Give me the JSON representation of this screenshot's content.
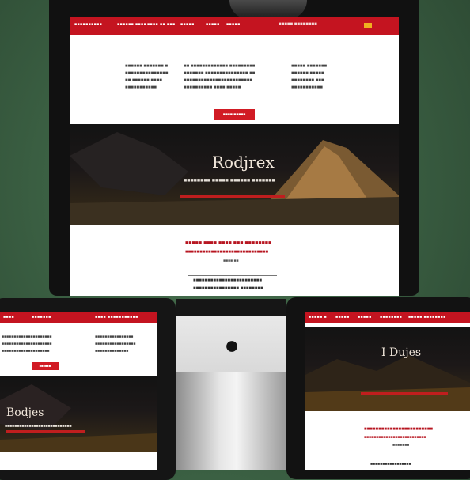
{
  "colors": {
    "brand_red": "#c41420",
    "hero_dark": "#161616",
    "background_green": "#3b6043"
  },
  "main_screen": {
    "nav_links": [
      "■■■■■■■■■■",
      "■■■■■■ ■■■■",
      "■■■■ ■■ ■■■",
      "■■■■■",
      "■■■■■",
      "■■■■■"
    ],
    "brand_name": "■■■■■ ■■■■■■■■",
    "columns": [
      [
        "■■■■■■ ■■■■■■■ ■",
        "■■■■■■■■■■■■■■■",
        "■■ ■■■■■■ ■■■■",
        "■■■■■■■■■■■"
      ],
      [
        "■■ ■■■■■■■■■■■■■ ■■■■■■■■■",
        "■■■■■■■ ■■■■■■■■■■■■■■■ ■■",
        "■■■■■■■■■■■■■■■■■■■■■■■■",
        "■■■■■■■■■■ ■■■■ ■■■■■"
      ],
      [
        "■■■■■ ■■■■■■■",
        "■■■■■■ ■■■■■",
        "■■■■■■■■ ■■■",
        "■■■■■■■■■■■"
      ]
    ],
    "cta_label": "■■■■ ■■■■■",
    "hero_title": "Rodjrex",
    "hero_subtitle": "■■■■■■■■ ■■■■■ ■■■■■■ ■■■■■■■",
    "section_heading": "■■■■■ ■■■■ ■■■■ ■■■ ■■■■■■■■",
    "section_subheading": "■■■■■■■■■■■■■■■■■■■■■■■■■■■■■",
    "section_small": "■■■■ ■■",
    "bottom_heading": "■■■■■■■■■■■■■■■■■■■■■■■■",
    "bottom_text": "■■■■■■■■■■■■■■■■ ■■■■■■■■"
  },
  "left_tablet": {
    "nav_links": [
      "■■■■",
      "■■■■■■■",
      "■■■■ ■■■■■■■■■■■"
    ],
    "columns": [
      [
        "■■■■■■■■■■■■■■■■■■■■■",
        "■■■■■■■■■■■■■■■■■■■■■",
        "■■■■■■■■■■■■■■■■■■■■"
      ],
      [
        "■■■■■■■■■■■■■■■■",
        "■■■■■■■■■■■■■■■■■",
        "■■■■■■■■■■■■■■"
      ]
    ],
    "cta_label": "■■■■■■",
    "hero_title": "Bodjes",
    "hero_subtitle": "■■■■■■■■■■■■■■■■■■■■■■■■■■■■"
  },
  "right_tablet": {
    "nav_links": [
      "■■■■■ ■",
      "■■■■■",
      "■■■■■",
      "■■■■■■■■",
      "■■■■■ ■■■■■■■■"
    ],
    "hero_title": "I Dujes",
    "section_heading": "■■■■■■■■■■■■■■■■■■■■■■■■",
    "section_subheading": "■■■■■■■■■■■■■■■■■■■■■■■■■■",
    "small_text": "■■■■■■■",
    "bottom_text": "■■■■■■■■■■■■■■■■■"
  },
  "icons": {
    "apple_logo": "apple-logo-icon"
  }
}
